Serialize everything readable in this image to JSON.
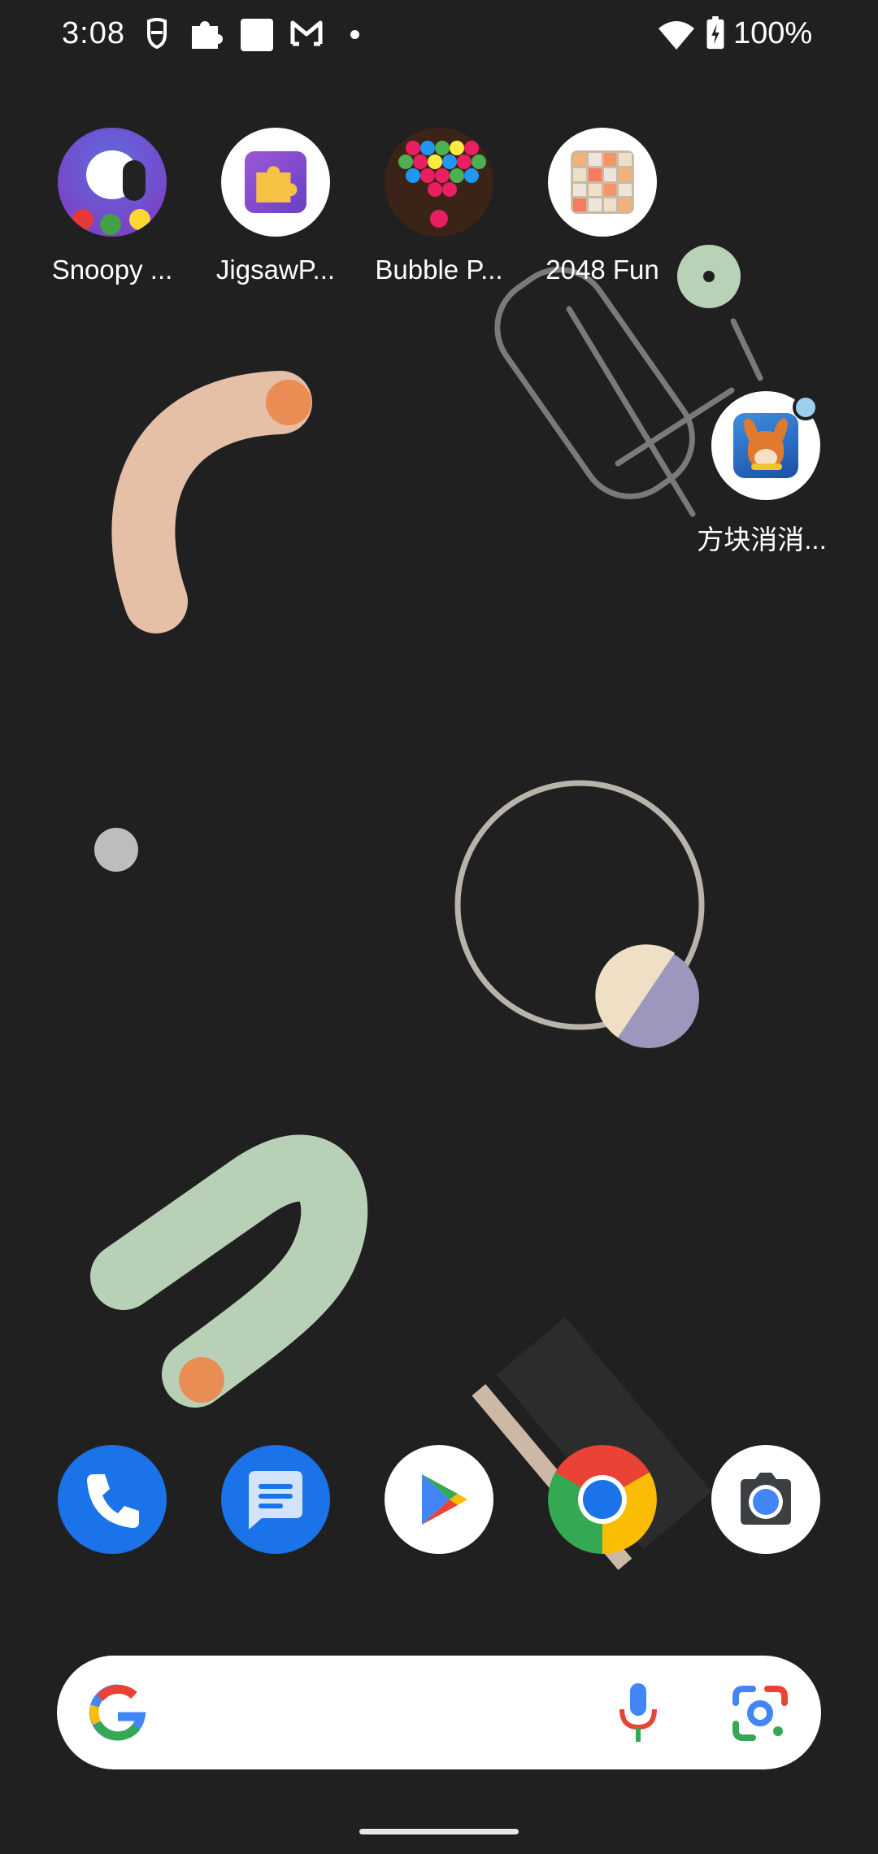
{
  "status_bar": {
    "time": "3:08",
    "battery_percent": "100%",
    "notification_icons": [
      "bubble-shield-icon",
      "puzzle-icon",
      "square-icon",
      "gmail-icon",
      "dot-icon"
    ],
    "system_icons": [
      "wifi-icon",
      "battery-charging-icon"
    ]
  },
  "home": {
    "apps": [
      {
        "label": "Snoopy ...",
        "icon": "snoopy-app-icon"
      },
      {
        "label": "JigsawP...",
        "icon": "jigsaw-puzzle-app-icon"
      },
      {
        "label": "Bubble P...",
        "icon": "bubble-pop-app-icon"
      },
      {
        "label": "2048 Fun",
        "icon": "2048-app-icon"
      },
      {
        "label": "方块消消...",
        "icon": "block-match-app-icon"
      }
    ]
  },
  "dock": {
    "apps": [
      {
        "name": "Phone",
        "icon": "phone-icon"
      },
      {
        "name": "Messages",
        "icon": "messages-icon"
      },
      {
        "name": "Play Store",
        "icon": "play-store-icon"
      },
      {
        "name": "Chrome",
        "icon": "chrome-icon"
      },
      {
        "name": "Camera",
        "icon": "camera-icon"
      }
    ]
  },
  "search": {
    "icons": [
      "google-g-icon",
      "microphone-icon",
      "google-lens-icon"
    ]
  },
  "colors": {
    "background": "#202020",
    "phone_blue": "#1a73e8",
    "google_blue": "#4285f4",
    "google_red": "#ea4335",
    "google_yellow": "#fbbc04",
    "google_green": "#34a853"
  }
}
